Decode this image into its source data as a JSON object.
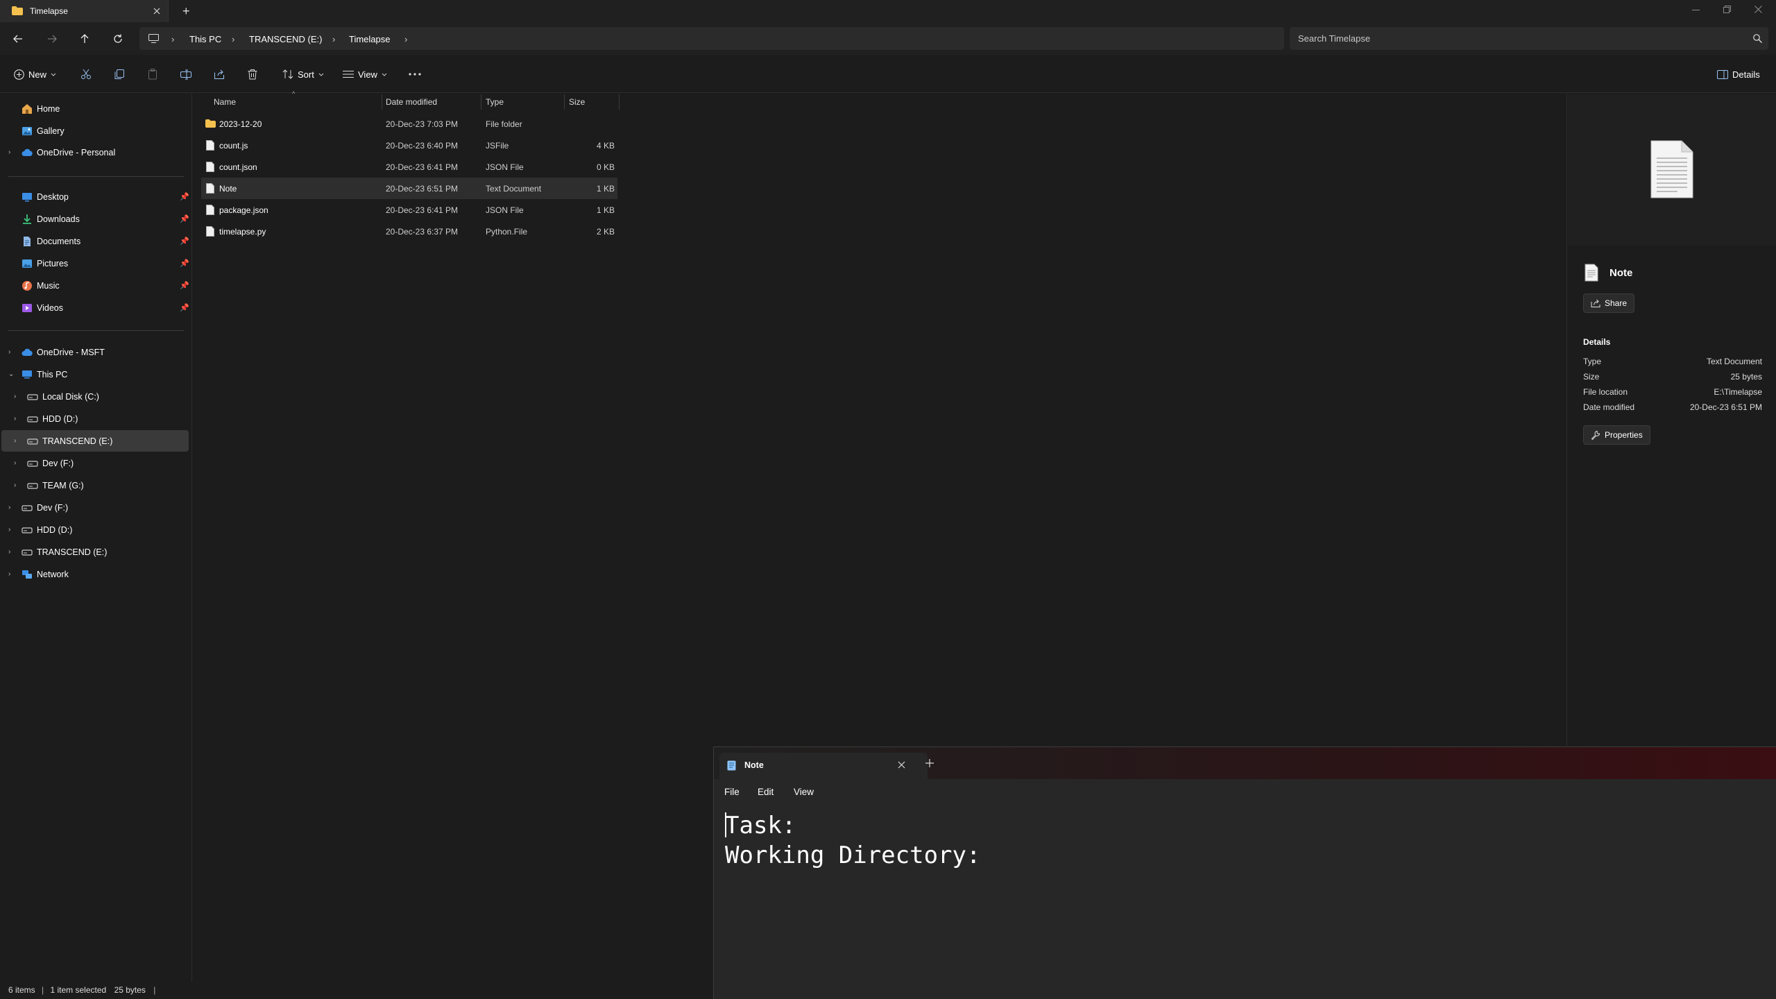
{
  "window": {
    "tab_title": "Timelapse",
    "new_tab_glyph": "+"
  },
  "address": {
    "breadcrumbs": [
      "This PC",
      "TRANSCEND (E:)",
      "Timelapse"
    ],
    "search_placeholder": "Search Timelapse"
  },
  "toolbar": {
    "new_label": "New",
    "sort_label": "Sort",
    "view_label": "View",
    "details_label": "Details"
  },
  "sidebar": {
    "items": [
      {
        "label": "Home",
        "icon": "home-icon"
      },
      {
        "label": "Gallery",
        "icon": "gallery-icon"
      },
      {
        "label": "OneDrive - Personal",
        "icon": "cloud-icon"
      },
      {
        "label": "Desktop",
        "icon": "desktop-icon"
      },
      {
        "label": "Downloads",
        "icon": "download-icon"
      },
      {
        "label": "Documents",
        "icon": "documents-icon"
      },
      {
        "label": "Pictures",
        "icon": "pictures-icon"
      },
      {
        "label": "Music",
        "icon": "music-icon"
      },
      {
        "label": "Videos",
        "icon": "videos-icon"
      },
      {
        "label": "OneDrive - MSFT",
        "icon": "cloud-icon"
      },
      {
        "label": "This PC",
        "icon": "computer-icon"
      },
      {
        "label": "Local Disk (C:)",
        "icon": "drive-icon"
      },
      {
        "label": "HDD (D:)",
        "icon": "drive-icon"
      },
      {
        "label": "TRANSCEND (E:)",
        "icon": "drive-icon"
      },
      {
        "label": "Dev (F:)",
        "icon": "drive-icon"
      },
      {
        "label": "TEAM (G:)",
        "icon": "drive-icon"
      },
      {
        "label": "Dev (F:)",
        "icon": "drive-icon"
      },
      {
        "label": "HDD (D:)",
        "icon": "drive-icon"
      },
      {
        "label": "TRANSCEND (E:)",
        "icon": "drive-icon"
      },
      {
        "label": "Network",
        "icon": "network-icon"
      }
    ]
  },
  "filelist": {
    "columns": [
      "Name",
      "Date modified",
      "Type",
      "Size"
    ],
    "rows": [
      {
        "name": "2023-12-20",
        "date": "20-Dec-23 7:03 PM",
        "type": "File folder",
        "size": "",
        "icon": "folder-icon"
      },
      {
        "name": "count.js",
        "date": "20-Dec-23 6:40 PM",
        "type": "JSFile",
        "size": "4 KB",
        "icon": "file-icon"
      },
      {
        "name": "count.json",
        "date": "20-Dec-23 6:41 PM",
        "type": "JSON File",
        "size": "0 KB",
        "icon": "file-icon"
      },
      {
        "name": "Note",
        "date": "20-Dec-23 6:51 PM",
        "type": "Text Document",
        "size": "1 KB",
        "icon": "file-icon"
      },
      {
        "name": "package.json",
        "date": "20-Dec-23 6:41 PM",
        "type": "JSON File",
        "size": "1 KB",
        "icon": "file-icon"
      },
      {
        "name": "timelapse.py",
        "date": "20-Dec-23 6:37 PM",
        "type": "Python.File",
        "size": "2 KB",
        "icon": "file-icon"
      }
    ]
  },
  "details": {
    "file_name": "Note",
    "share_label": "Share",
    "section_title": "Details",
    "props": [
      {
        "label": "Type",
        "value": "Text Document"
      },
      {
        "label": "Size",
        "value": "25 bytes"
      },
      {
        "label": "File location",
        "value": "E:\\Timelapse"
      },
      {
        "label": "Date modified",
        "value": "20-Dec-23 6:51 PM"
      }
    ],
    "properties_label": "Properties"
  },
  "status": {
    "items": "6 items",
    "selected": "1 item selected",
    "size": "25 bytes"
  },
  "notepad": {
    "tab_title": "Note",
    "menu": [
      "File",
      "Edit",
      "View"
    ],
    "line1": "Task:",
    "line2": "Working Directory:"
  }
}
